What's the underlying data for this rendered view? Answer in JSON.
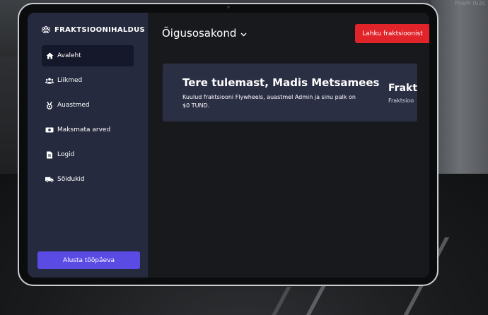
{
  "corner_label": "FiveM (b2c",
  "sidebar": {
    "title": "FRAKTSIOONIHALDUS",
    "title_icon": "users-icon",
    "items": [
      {
        "label": "Avaleht",
        "icon": "home-icon",
        "active": true
      },
      {
        "label": "Liikmed",
        "icon": "users-icon",
        "active": false
      },
      {
        "label": "Auastmed",
        "icon": "medal-icon",
        "active": false
      },
      {
        "label": "Maksmata arved",
        "icon": "money-bill-icon",
        "active": false
      },
      {
        "label": "Logid",
        "icon": "file-icon",
        "active": false
      },
      {
        "label": "Sõidukid",
        "icon": "truck-icon",
        "active": false
      }
    ],
    "start_button": "Alusta tööpäeva"
  },
  "header": {
    "department": "Õigusosakond",
    "leave_button": "Lahku fraktsioonist"
  },
  "welcome_card": {
    "title": "Tere tulemast, Madis Metsamees",
    "text": "Kuulud fraktsiooni Flywheels, auastmel Admin ja sinu palk on $0 TUND."
  },
  "info_card": {
    "title": "Frakt",
    "text": "Fraktsioo"
  },
  "colors": {
    "sidebar_bg": "#252a3e",
    "active_item_bg": "#15172a",
    "primary_button": "#5a4be4",
    "danger_button": "#e0242a",
    "card_bg": "#2b2f44",
    "screen_bg": "#18191d"
  }
}
